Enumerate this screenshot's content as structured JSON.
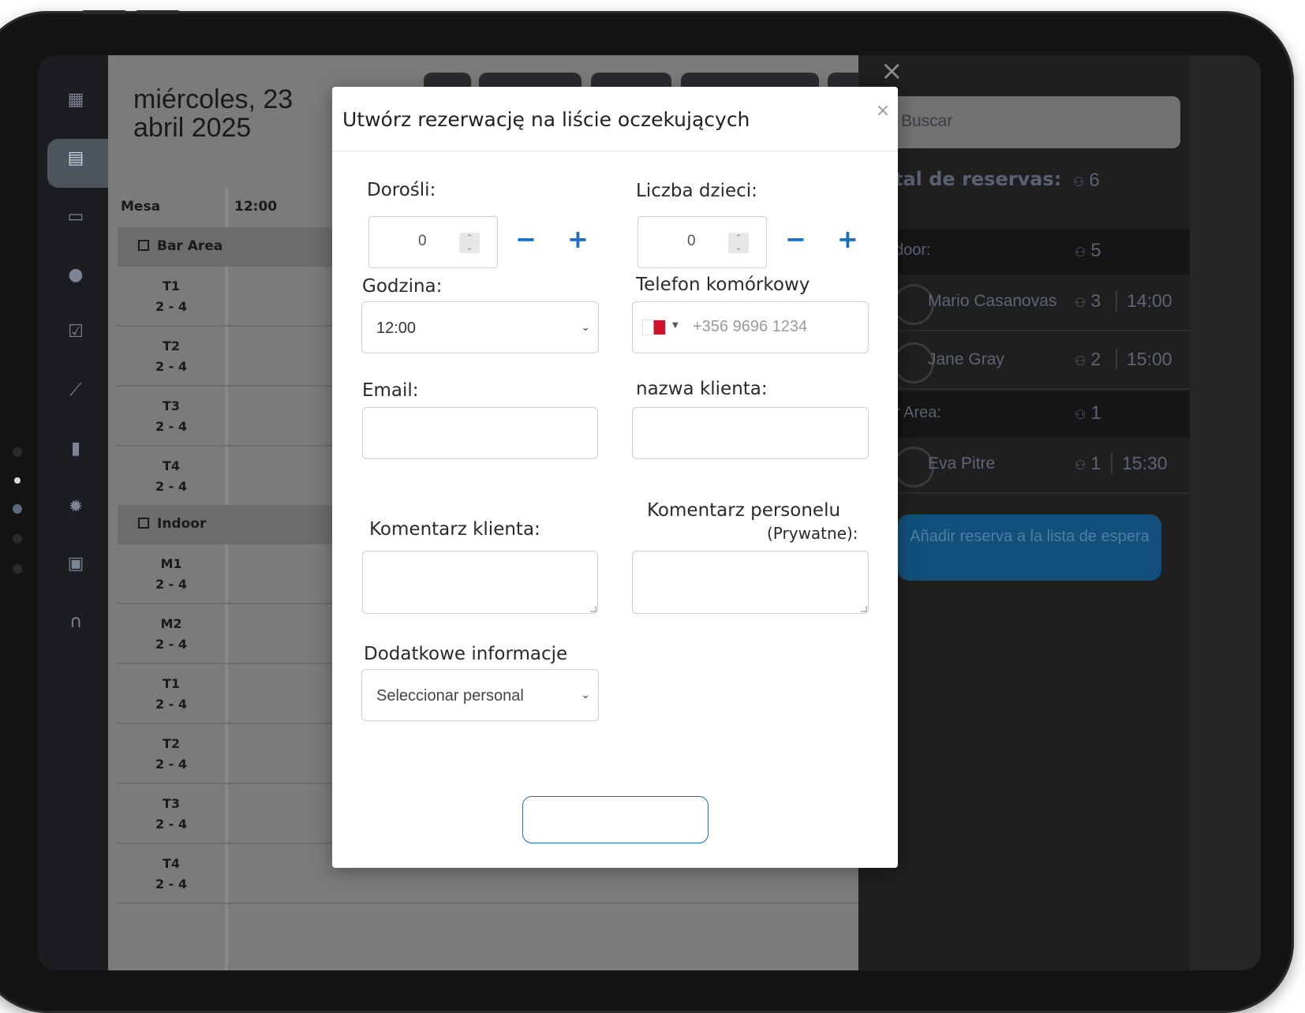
{
  "calendar": {
    "date_line1": "miércoles, 23",
    "date_line2": "abril 2025",
    "col_table": "Mesa",
    "col_time": "12:00",
    "sections": [
      {
        "label": "Bar Area",
        "tables": [
          {
            "name": "T1",
            "cap": "2 - 4"
          },
          {
            "name": "T2",
            "cap": "2 - 4"
          },
          {
            "name": "T3",
            "cap": "2 - 4"
          },
          {
            "name": "T4",
            "cap": "2 - 4"
          }
        ]
      },
      {
        "label": "Indoor",
        "tables": [
          {
            "name": "M1",
            "cap": "2 - 4"
          },
          {
            "name": "M2",
            "cap": "2 - 4"
          },
          {
            "name": "T1",
            "cap": "2 - 4"
          },
          {
            "name": "T2",
            "cap": "2 - 4"
          },
          {
            "name": "T3",
            "cap": "2 - 4"
          },
          {
            "name": "T4",
            "cap": "2 - 4"
          }
        ]
      }
    ]
  },
  "waitlist_panel": {
    "close_icon": "close-icon",
    "search_placeholder": "Buscar",
    "total_label": "tal de reservas:",
    "total_count": "6",
    "areas": [
      {
        "label": "door:",
        "count": "5"
      },
      {
        "label": "r Area:",
        "count": "1"
      }
    ],
    "entries": [
      {
        "name": "Mario Casanovas",
        "party": "3",
        "time": "14:00"
      },
      {
        "name": "Jane Gray",
        "party": "2",
        "time": "15:00"
      },
      {
        "name": "Eva Pitre",
        "party": "1",
        "time": "15:30"
      }
    ],
    "add_button": "Añadir reserva a la lista de espera"
  },
  "modal": {
    "title": "Utwórz rezerwację na liście oczekujących",
    "close": "×",
    "adults_label": "Dorośli:",
    "adults_value": "0",
    "children_label": "Liczba dzieci:",
    "children_value": "0",
    "minus": "−",
    "plus": "+",
    "time_label": "Godzina:",
    "time_value": "12:00",
    "phone_label": "Telefon komórkowy",
    "phone_placeholder": "+356 9696 1234",
    "phone_flag": "Malta",
    "email_label": "Email:",
    "client_name_label": "nazwa klienta:",
    "client_comment_label": "Komentarz klienta:",
    "staff_comment_label": "Komentarz personelu",
    "staff_comment_sub": "(Prywatne):",
    "extra_info_label": "Dodatkowe informacje",
    "extra_info_value": "Seleccionar personal",
    "submit_label": ""
  },
  "colors": {
    "accent": "#1b6fbd",
    "overlay_dark": "#1f1f20",
    "panel_button": "#124f7a"
  }
}
